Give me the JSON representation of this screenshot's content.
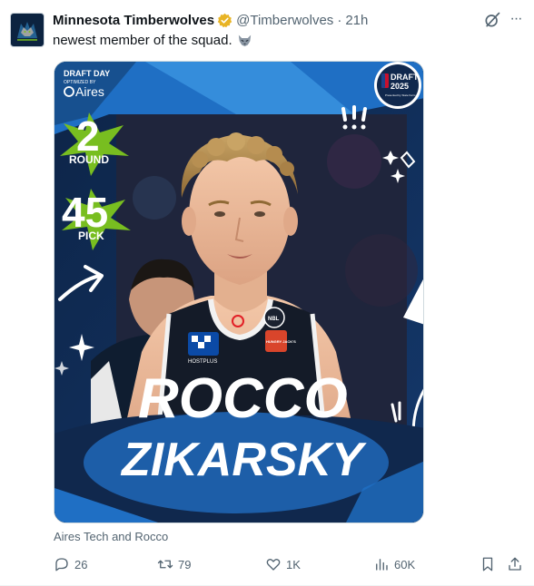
{
  "tweet": {
    "display_name": "Minnesota Timberwolves",
    "handle": "@Timberwolves",
    "separator": "·",
    "time": "21h",
    "text": "newest member of the squad.",
    "caption": "Aires Tech and Rocco"
  },
  "media": {
    "draft_day": "DRAFT DAY",
    "optimized_by": "OPTIMIZED BY",
    "sponsor": "Aires",
    "round_number": "2",
    "round_label": "ROUND",
    "pick_number": "45",
    "pick_label": "PICK",
    "badge_top": "DRAFT",
    "badge_year": "2025",
    "badge_sub": "Presented by State Farm",
    "player_first": "ROCCO",
    "player_last": "ZIKARSKY",
    "jersey_logo": "NBL",
    "jersey_sponsor": "HUNGRY JACK'S",
    "jersey_partner": "HOSTPLUS",
    "accent_color": "#78be20",
    "background_color": "#10284d",
    "band_color": "#1d5ea8"
  },
  "actions": {
    "replies": "26",
    "reposts": "79",
    "likes": "1K",
    "views": "60K"
  },
  "icons": [
    "verified-badge-icon",
    "wolf-emoji-icon",
    "grok-icon",
    "more-icon",
    "reply-icon",
    "repost-icon",
    "like-icon",
    "views-icon",
    "bookmark-icon",
    "share-icon"
  ]
}
